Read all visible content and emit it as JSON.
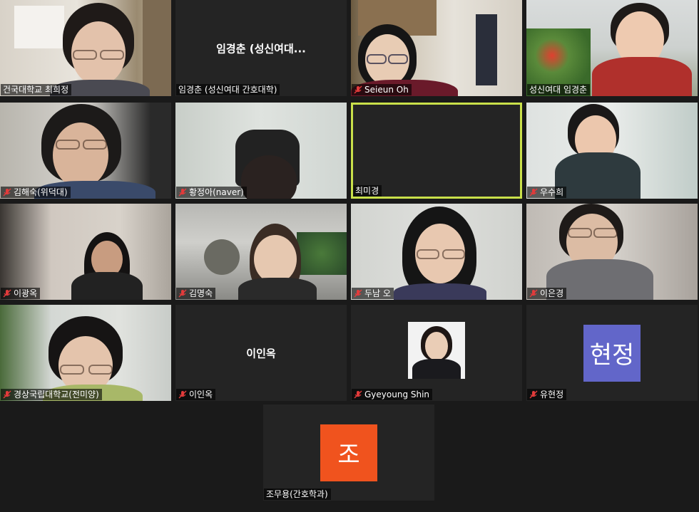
{
  "participants": [
    {
      "name": "건국대학교 최희정",
      "muted": false
    },
    {
      "name": "임경춘 (성신여대 간호대학)",
      "muted": false,
      "display_name": "임경춘 (성신여대..."
    },
    {
      "name": "Seieun Oh",
      "muted": true
    },
    {
      "name": "성신여대 임경춘",
      "muted": false
    },
    {
      "name": "김해숙(위덕대)",
      "muted": true
    },
    {
      "name": "황정아(naver)",
      "muted": true
    },
    {
      "name": "최미경",
      "muted": false,
      "active_speaker": true
    },
    {
      "name": "우수희",
      "muted": true
    },
    {
      "name": "이광옥",
      "muted": true
    },
    {
      "name": "김명숙",
      "muted": true
    },
    {
      "name": "두남 오",
      "muted": true
    },
    {
      "name": "이은경",
      "muted": true
    },
    {
      "name": "경상국립대학교(전미양)",
      "muted": true
    },
    {
      "name": "이인옥",
      "muted": true,
      "display_name": "이인옥"
    },
    {
      "name": "Gyeyoung Shin",
      "muted": true
    },
    {
      "name": "유현정",
      "muted": true,
      "avatar_text": "현정",
      "avatar_color": "#6266c9"
    },
    {
      "name": "조무용(간호학과)",
      "muted": false,
      "avatar_text": "조",
      "avatar_color": "#f0531e"
    }
  ],
  "colors": {
    "background": "#1a1a1a",
    "active_border": "#c9e04a",
    "muted_icon": "#e23b3b"
  }
}
